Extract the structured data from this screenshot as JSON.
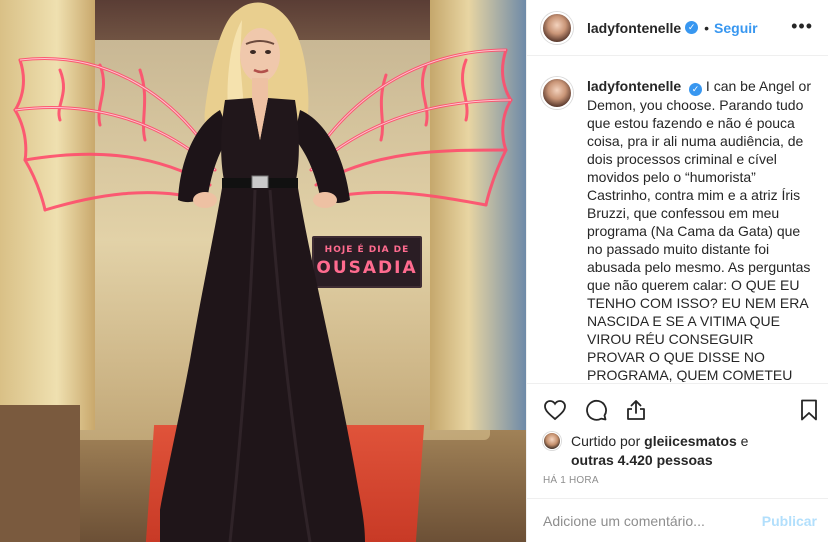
{
  "post": {
    "username": "ladyfontenelle",
    "verified_glyph": "✓",
    "separator": "•",
    "follow_label": "Seguir",
    "more_glyph": "•••",
    "caption": "I can be Angel or Demon, you choose. Parando tudo que estou fazendo e não é pouca coisa, pra ir ali numa audiência, de dois processos criminal e cível movidos pelo o “humorista” Castrinho, contra mim e a atriz Íris Bruzzi, que confessou em meu programa (Na Cama da Gata) que no passado muito distante foi abusada pelo mesmo. As perguntas que não querem calar: O QUE EU TENHO COM ISSO? EU NEM ERA NASCIDA E SE A VITIMA QUE VIROU RÉU CONSEGUIR PROVAR O QUE DISSE NO PROGRAMA, QUEM COMETEU CRIME AQUI? Dito isso, Sr Juiz, espero que essa palhaçada pare por aqui. Grata pela compreensão.",
    "sign_line1": "HOJE É DIA DE",
    "sign_line2": "OUSADIA",
    "likes": {
      "prefix": "Curtido por",
      "liker": "gleiicesmatos",
      "conjunction": "e",
      "others": "outras 4.420 pessoas"
    },
    "timestamp": "HÁ 1 HORA",
    "comment_placeholder": "Adicione um comentário...",
    "publish_label": "Publicar"
  },
  "icons": [
    "heart-icon",
    "comment-icon",
    "share-icon",
    "bookmark-icon",
    "more-options-icon",
    "verified-icon"
  ],
  "colors": {
    "accent": "#3897f0",
    "publish_disabled": "#b2dffc",
    "muted": "#8e8e8e",
    "text": "#262626",
    "divider": "#efefef"
  }
}
